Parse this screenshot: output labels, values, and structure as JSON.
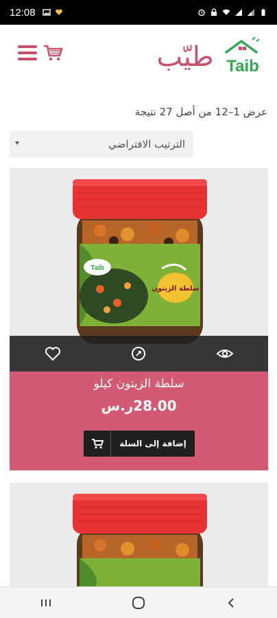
{
  "status_bar": {
    "time": "12:08",
    "left_icons": [
      "image-icon",
      "heart-notification-icon"
    ],
    "right_icons": [
      "alarm-icon",
      "lock-icon",
      "wifi-icon",
      "signal-icon",
      "signal-icon",
      "battery-icon"
    ]
  },
  "header": {
    "logo_arabic": "طيّب",
    "logo_latin": "Taib",
    "brand_color": "#c8506b",
    "logo_green": "#2fa84f"
  },
  "results": {
    "text": "عرض 1–12 من أصل 27 نتيجة"
  },
  "sort": {
    "selected": "الترتيب الافتراضي"
  },
  "products": [
    {
      "name": "سلطة الزيتون كيلو",
      "price": "28.00ر.س",
      "add_to_cart_label": "إضافة إلى السلة",
      "label_text": "سلطة الزيتون",
      "jar_brand": "Taib"
    },
    {
      "name": "",
      "price": "",
      "add_to_cart_label": "",
      "jar_brand": ""
    }
  ],
  "colors": {
    "card_info_bg": "#d25a72",
    "overlay_bar_bg": "#1e1e1e",
    "button_bg": "#1f1f1f",
    "jar_lid": "#e63232"
  },
  "icons": {
    "overlay": [
      "heart-icon",
      "compare-icon",
      "eye-icon"
    ],
    "nav": [
      "recent-apps-icon",
      "home-icon",
      "back-icon"
    ]
  }
}
